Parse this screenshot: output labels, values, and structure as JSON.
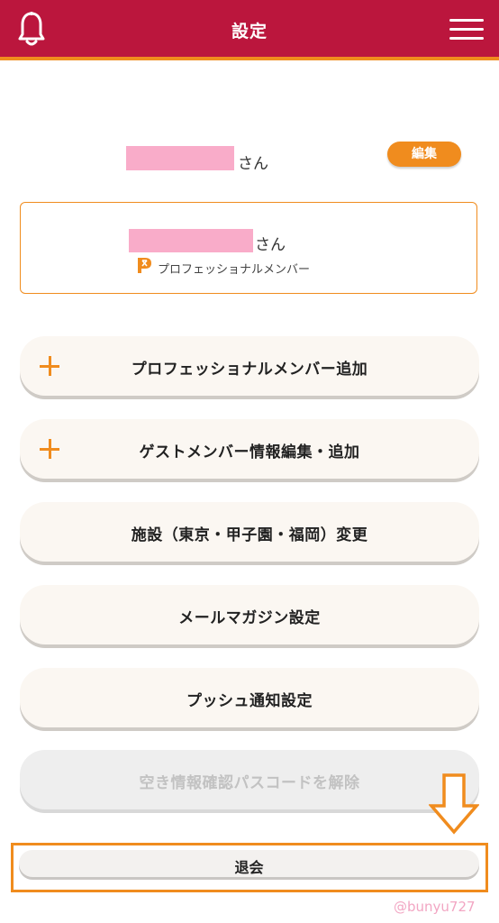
{
  "header": {
    "title": "設定"
  },
  "user": {
    "name_suffix": "さん",
    "edit_label": "編集"
  },
  "member_card": {
    "name_suffix": "さん",
    "type_label": "プロフェッショナルメンバー"
  },
  "menu_buttons": [
    {
      "label": "プロフェッショナルメンバー追加"
    },
    {
      "label": "ゲストメンバー情報編集・追加"
    },
    {
      "label": "施設（東京・甲子園・福岡）変更"
    },
    {
      "label": "メールマガジン設定"
    },
    {
      "label": "プッシュ通知設定"
    },
    {
      "label": "空き情報確認パスコードを解除"
    }
  ],
  "withdraw": {
    "label": "退会"
  },
  "watermark": "@bunyu727",
  "colors": {
    "header_bg": "#bb163d",
    "accent": "#f08c1e",
    "redaction": "#f9acc9"
  },
  "icons": {
    "header_left": "bell-icon",
    "header_right": "hamburger-menu-icon",
    "add": "plus-icon",
    "member_badge": "p-badge-icon",
    "annotation": "down-arrow-icon"
  }
}
